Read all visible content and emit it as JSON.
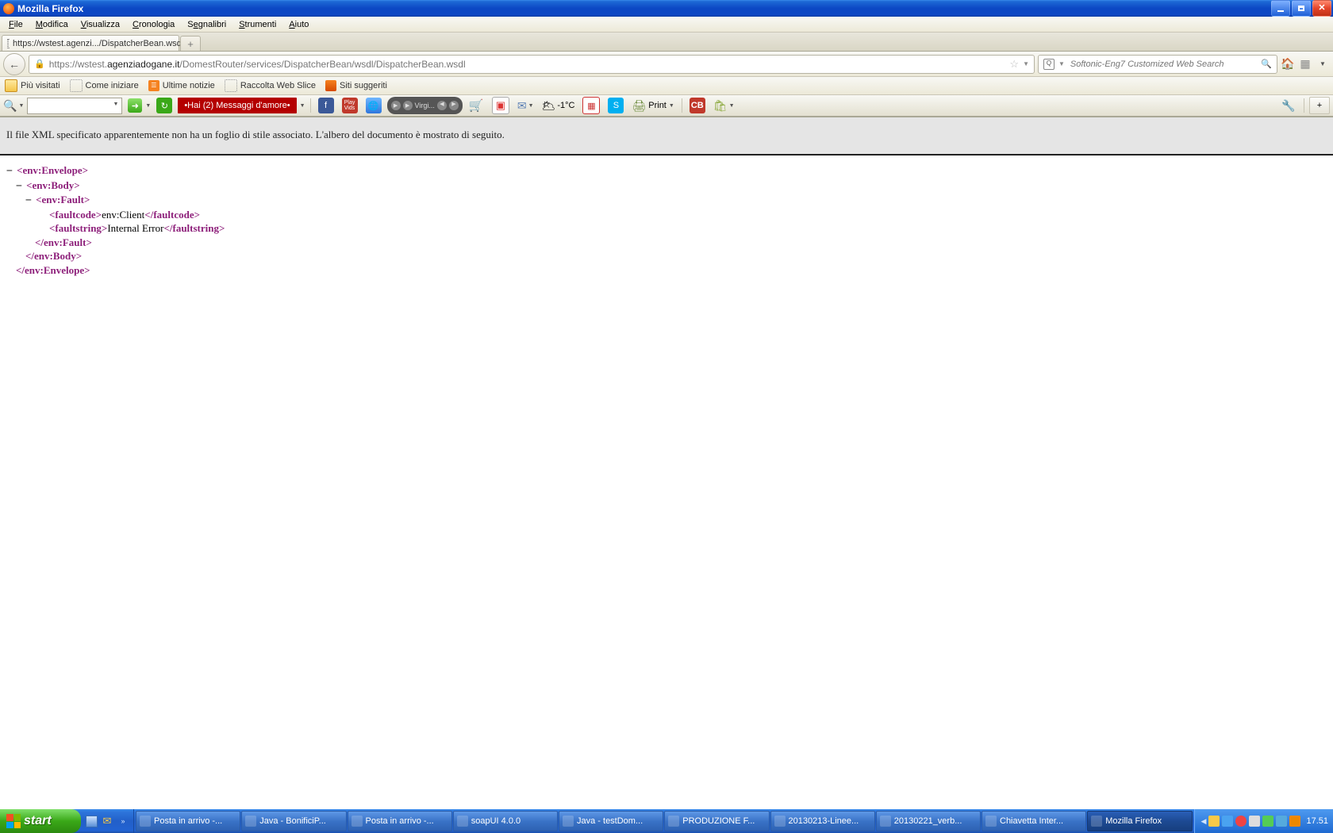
{
  "window": {
    "title": "Mozilla Firefox"
  },
  "menubar": [
    {
      "pre": "",
      "u": "F",
      "post": "ile"
    },
    {
      "pre": "",
      "u": "M",
      "post": "odifica"
    },
    {
      "pre": "",
      "u": "V",
      "post": "isualizza"
    },
    {
      "pre": "",
      "u": "C",
      "post": "ronologia"
    },
    {
      "pre": "S",
      "u": "e",
      "post": "gnalibri"
    },
    {
      "pre": "",
      "u": "S",
      "post": "trumenti"
    },
    {
      "pre": "",
      "u": "A",
      "post": "iuto"
    }
  ],
  "tab": {
    "label": "https://wstest.agenzi.../DispatcherBean.wsdl"
  },
  "url": {
    "prefix": "https://wstest.",
    "host": "agenziadogane.it",
    "path": "/DomestRouter/services/DispatcherBean/wsdl/DispatcherBean.wsdl"
  },
  "search": {
    "placeholder": "Softonic-Eng7 Customized Web Search",
    "glyph": "Q"
  },
  "bookmarks": [
    {
      "icon": "folder",
      "label": "Più visitati"
    },
    {
      "icon": "page",
      "label": "Come iniziare"
    },
    {
      "icon": "rss",
      "label": "Ultime notizie"
    },
    {
      "icon": "page",
      "label": "Raccolta Web Slice"
    },
    {
      "icon": "orb",
      "label": "Siti suggeriti"
    }
  ],
  "addonbar": {
    "message": "•Hai (2) Messaggi d'amore•",
    "virgin": "Virgi...",
    "temp": "-1°C",
    "print": "Print",
    "cb": "CB"
  },
  "notice": "Il file XML specificato apparentemente non ha un foglio di stile associato. L'albero del documento è mostrato di seguito.",
  "xml": {
    "envOpen": "env:Envelope",
    "bodyOpen": "env:Body",
    "faultOpen": "env:Fault",
    "faultcode": "faultcode",
    "faultcodeVal": "env:Client",
    "faultstring": "faultstring",
    "faultstringVal": "Internal Error",
    "faultClose": "env:Fault",
    "bodyClose": "env:Body",
    "envClose": "env:Envelope"
  },
  "taskbar": {
    "start": "start",
    "items": [
      "Posta in arrivo -...",
      "Java - BonificiP...",
      "Posta in arrivo -...",
      "soapUI 4.0.0",
      "Java - testDom...",
      "PRODUZIONE F...",
      "20130213-Linee...",
      "20130221_verb...",
      "Chiavetta Inter...",
      "Mozilla Firefox"
    ],
    "clock": "17.51"
  }
}
